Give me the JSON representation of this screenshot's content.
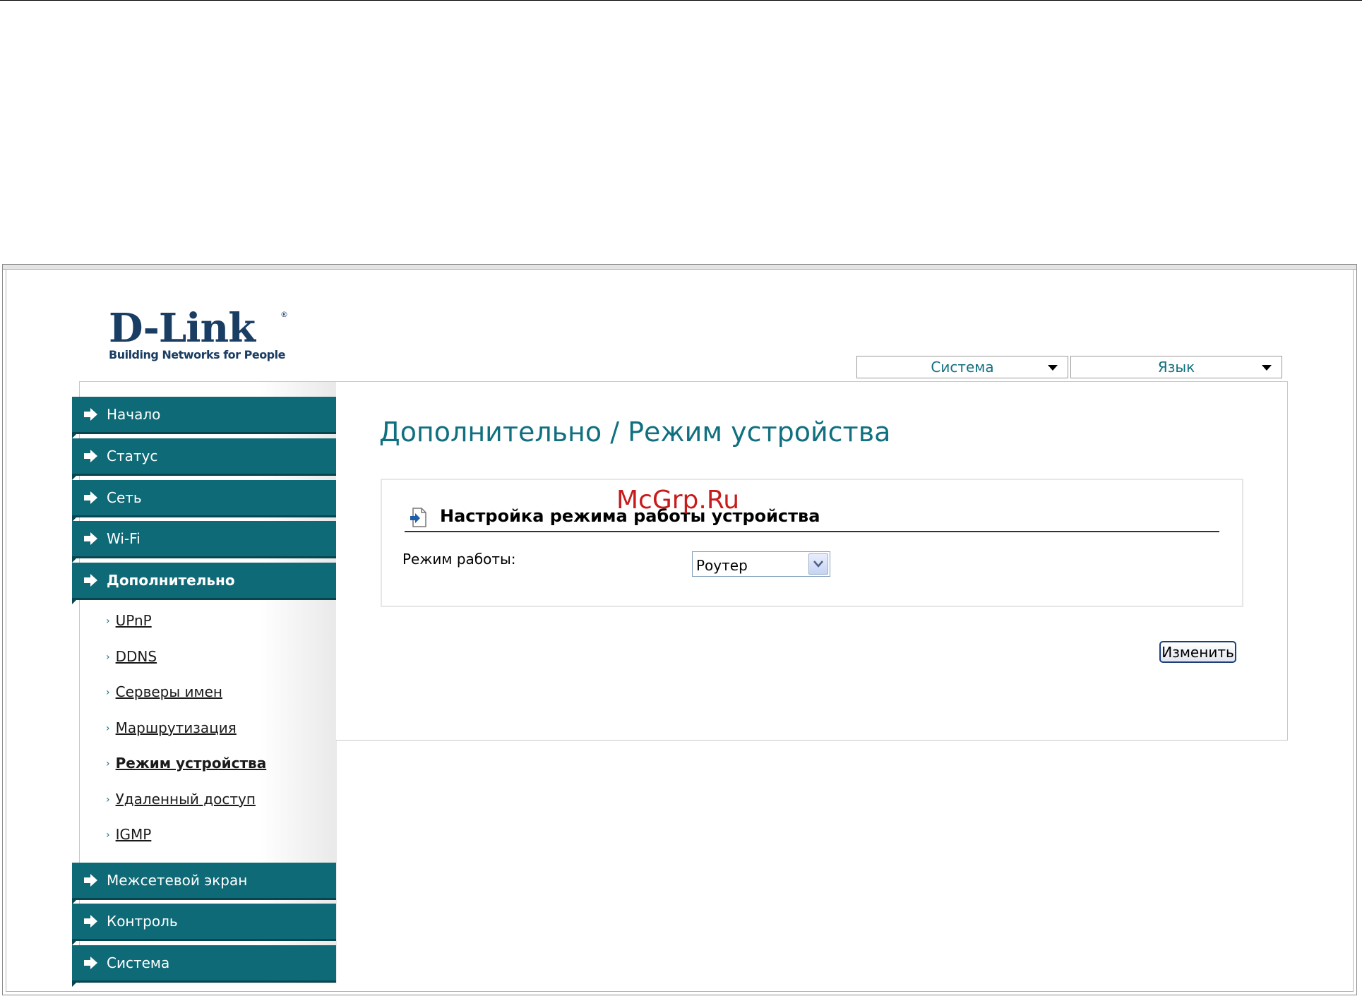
{
  "logo": {
    "name": "D-Link",
    "registered": "®",
    "tagline": "Building Networks for People"
  },
  "top_menus": {
    "system": "Система",
    "language": "Язык"
  },
  "sidebar": {
    "items_top": [
      {
        "label": "Начало"
      },
      {
        "label": "Статус"
      },
      {
        "label": "Сеть"
      },
      {
        "label": "Wi-Fi"
      },
      {
        "label": "Дополнительно",
        "active": true
      }
    ],
    "subitems": [
      {
        "label": "UPnP"
      },
      {
        "label": "DDNS"
      },
      {
        "label": "Серверы имен"
      },
      {
        "label": "Маршрутизация"
      },
      {
        "label": "Режим устройства",
        "active": true
      },
      {
        "label": "Удаленный доступ"
      },
      {
        "label": "IGMP"
      }
    ],
    "items_bottom": [
      {
        "label": "Межсетевой экран"
      },
      {
        "label": "Контроль"
      },
      {
        "label": "Система"
      }
    ]
  },
  "main": {
    "title": "Дополнительно /  Режим устройства",
    "section_title": "Настройка режима работы устройства",
    "mode_label": "Режим работы:",
    "mode_value": "Роутер",
    "change_button": "Изменить"
  },
  "watermark": "McGrp.Ru",
  "colors": {
    "teal": "#0e6a76",
    "title_teal": "#10707f",
    "logo_navy": "#1a3d63",
    "watermark_red": "#c81c1c"
  },
  "icons": {
    "nav": "arrow-right-icon",
    "section": "document-arrow-icon",
    "dropdown": "chevron-down-icon"
  }
}
